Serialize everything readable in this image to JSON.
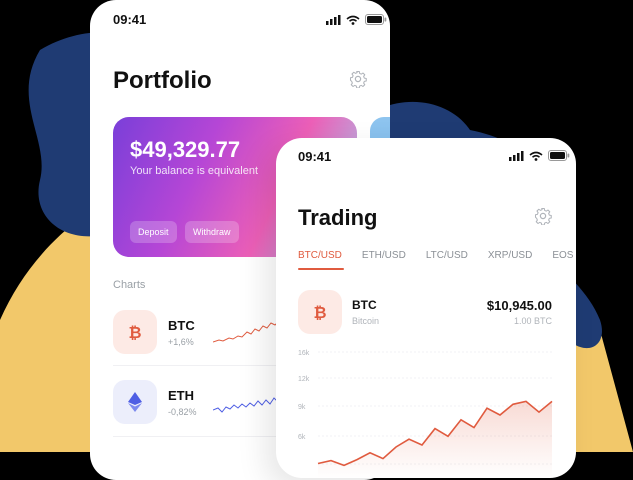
{
  "colors": {
    "accent": "#e05b3f",
    "blob_navy": "#1f3b73",
    "blob_yellow": "#f2c86a",
    "eth_blue": "#4e5ee4"
  },
  "portfolio": {
    "status_time": "09:41",
    "title": "Portfolio",
    "balance": "$49,329.77",
    "balance_caption": "Your balance is equivalent",
    "deposit_label": "Deposit",
    "withdraw_label": "Withdraw",
    "charts_label": "Charts",
    "coins": [
      {
        "symbol": "BTC",
        "change": "+1,6%",
        "icon": "bitcoin-icon"
      },
      {
        "symbol": "ETH",
        "change": "-0,82%",
        "icon": "ethereum-icon"
      }
    ]
  },
  "trading": {
    "status_time": "09:41",
    "title": "Trading",
    "tabs": [
      "BTC/USD",
      "ETH/USD",
      "LTC/USD",
      "XRP/USD",
      "EOS"
    ],
    "active_tab": "BTC/USD",
    "pair": {
      "symbol": "BTC",
      "name": "Bitcoin",
      "price": "$10,945.00",
      "amount": "1.00 BTC"
    },
    "y_ticks": [
      "16k",
      "12k",
      "9k",
      "6k"
    ]
  },
  "chart_data": {
    "type": "line",
    "title": "",
    "xlabel": "",
    "ylabel": "",
    "y_tick_labels": [
      "16k",
      "12k",
      "9k",
      "6k"
    ],
    "series": [
      {
        "values": [
          4.5,
          4.8,
          4.3,
          4.9,
          5.6,
          5.0,
          6.2,
          7.0,
          6.4,
          8.1,
          7.3,
          9.0,
          8.2,
          10.2,
          9.5,
          10.6,
          10.9,
          9.8,
          10.9
        ]
      }
    ]
  }
}
